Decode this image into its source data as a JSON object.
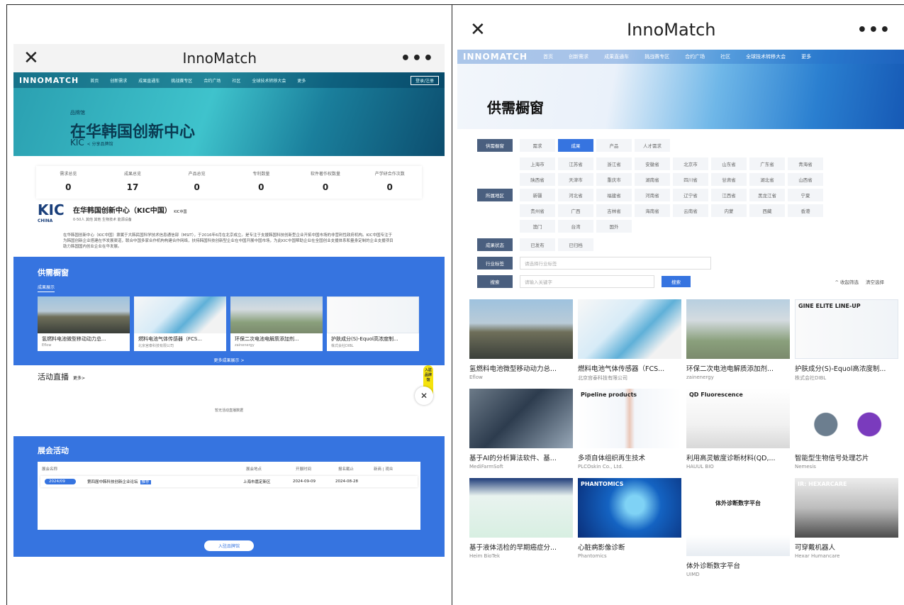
{
  "app_title": "InnoMatch",
  "left": {
    "nav": {
      "logo": "INNOMATCH",
      "items": [
        "首页",
        "创新需求",
        "成果直通车",
        "挑战赛专区",
        "合约广场",
        "社区",
        "全球技术转移大会",
        "更多"
      ],
      "login": "登录/注册"
    },
    "hero": {
      "tag": "品牌馆",
      "title": "在华韩国创新中心",
      "abbr": "KIC",
      "sub": "< 分享品牌馆"
    },
    "stats": [
      {
        "label": "需求总览",
        "value": "0"
      },
      {
        "label": "成果总览",
        "value": "17"
      },
      {
        "label": "产品总览",
        "value": "0"
      },
      {
        "label": "专利数量",
        "value": "0"
      },
      {
        "label": "软件著作权数量",
        "value": "0"
      },
      {
        "label": "产学研合作次数",
        "value": "0"
      }
    ],
    "org": {
      "logo": "KIC",
      "logo_sub": "CHINA",
      "name": "在华韩国创新中心（KIC中国）",
      "badge": "KIC中国",
      "tags": "0-50人  其他  其他  生物技术  能源设备"
    },
    "description": "在华韩国创新中心（KIC中国）隶属于大韩民国科学技术信息通信部（MSIT），于2016年6月在北京成立。是专注于支援韩国科技创新型企业开拓中国市场的非营利性政府机构。KIC中国专注于为韩国创新企业搭建在华发展渠道，联合中国多家合作机构构建合作网络，扶持韩国科技创新型企业在中国开展中国市场，为此KIC中国帮助企业在全国创业支援体系和量身定制的企业支援项目助力韩国国内创业企业在华发展。",
    "showcase": {
      "title": "供需橱窗",
      "tab": "成果展示",
      "cards": [
        {
          "title": "氢燃料电池微型移动动力总...",
          "sub": "Eflow"
        },
        {
          "title": "燃料电池气体传感器（FCS...",
          "sub": "北京宫泰科技有限公司"
        },
        {
          "title": "环保二次电池电解质添加剂...",
          "sub": "zainenergy"
        },
        {
          "title": "护肤成分(S)-Equol高浓度制...",
          "sub": "株式会社DIBL"
        }
      ],
      "more": "更多成果展示 >"
    },
    "live": {
      "title": "活动直播",
      "more": "更多>",
      "empty": "暂无活动直播数据"
    },
    "fab": "入驻品牌馆",
    "events": {
      "title": "展会活动",
      "headers": [
        "展会名称",
        "",
        "展会地点",
        "开展时间",
        "报名截止",
        "新商 | 观众"
      ],
      "row": {
        "date": "2024/09",
        "name": "第四届中韩科技创新企业论坛",
        "badge": "推荐",
        "place": "上海市嘉定新区",
        "start": "2024-09-09",
        "deadline": "2024-08-28"
      },
      "join": "入驻品牌馆"
    }
  },
  "right": {
    "nav": {
      "logo": "INNOMATCH",
      "items": [
        "首页",
        "创新需求",
        "成果直通车",
        "挑战赛专区",
        "合约广场",
        "社区",
        "全球技术转移大会",
        "更多"
      ]
    },
    "hero_title": "供需橱窗",
    "filters": {
      "type_label": "供需橱窗",
      "types": [
        "需求",
        "成果",
        "产品",
        "人才需求"
      ],
      "type_selected": 1,
      "region_label": "所属地区",
      "regions": [
        "上海市",
        "江苏省",
        "浙江省",
        "安徽省",
        "北京市",
        "山东省",
        "广东省",
        "青海省",
        "陕西省",
        "天津市",
        "重庆市",
        "湖南省",
        "四川省",
        "甘肃省",
        "湖北省",
        "山西省",
        "新疆",
        "河北省",
        "福建省",
        "河南省",
        "辽宁省",
        "江西省",
        "黑龙江省",
        "宁夏",
        "贵州省",
        "广西",
        "吉林省",
        "海南省",
        "云南省",
        "内蒙",
        "西藏",
        "香港",
        "澳门",
        "台湾",
        "国外"
      ],
      "status_label": "成果状态",
      "statuses": [
        "已发布",
        "已归档"
      ],
      "industry_label": "行业标签",
      "industry_placeholder": "请选择行业标签",
      "search_label": "搜索",
      "search_placeholder": "请输入关键字",
      "search_button": "搜索",
      "collapse": "^ 收起筛选",
      "clear": "清空选择"
    },
    "cards": [
      {
        "title": "氢燃料电池微型移动动力总...",
        "sub": "Eflow"
      },
      {
        "title": "燃料电池气体传感器（FCS...",
        "sub": "北京宫泰科技有限公司"
      },
      {
        "title": "环保二次电池电解质添加剂...",
        "sub": "zainenergy"
      },
      {
        "title": "护肤成分(S)-Equol高浓度制...",
        "sub": "株式会社DIBL"
      },
      {
        "title": "基于AI的分析算法软件、基...",
        "sub": "MediFarmSoft"
      },
      {
        "title": "多项自体组织再生技术",
        "sub": "PLCOskin Co., Ltd."
      },
      {
        "title": "利用高灵敏度诊断材料(QD,...",
        "sub": "HAUUL BIO"
      },
      {
        "title": "智能型生物信号处理芯片",
        "sub": "Nemesis"
      },
      {
        "title": "基于液体活检的早期癌症分...",
        "sub": "Heim BioTek"
      },
      {
        "title": "心脏病影像诊断",
        "sub": "Phantomics"
      },
      {
        "title": "体外诊断数字平台",
        "sub": "UIMD"
      },
      {
        "title": "可穿戴机器人",
        "sub": "Hexar Humancare"
      }
    ],
    "img_text": {
      "c3": "GINE ELITE LINE-UP",
      "c5": "Pipeline products",
      "c6": "QD Fluorescence",
      "c9": "PHANTOMICS",
      "c10": "体外诊断数字平台",
      "c11": "IR: HEXARCARE"
    }
  }
}
